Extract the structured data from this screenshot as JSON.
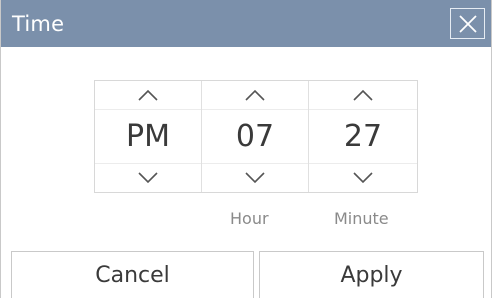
{
  "dialog": {
    "title": "Time"
  },
  "picker": {
    "period": "PM",
    "hour": "07",
    "minute": "27"
  },
  "labels": {
    "hour": "Hour",
    "minute": "Minute"
  },
  "buttons": {
    "cancel": "Cancel",
    "apply": "Apply"
  },
  "colors": {
    "titlebar": "#7b90ab",
    "text": "#3a3a3a",
    "label": "#8a8a8a"
  },
  "icons": {
    "close": "close-icon",
    "up": "chevron-up-icon",
    "down": "chevron-down-icon"
  }
}
